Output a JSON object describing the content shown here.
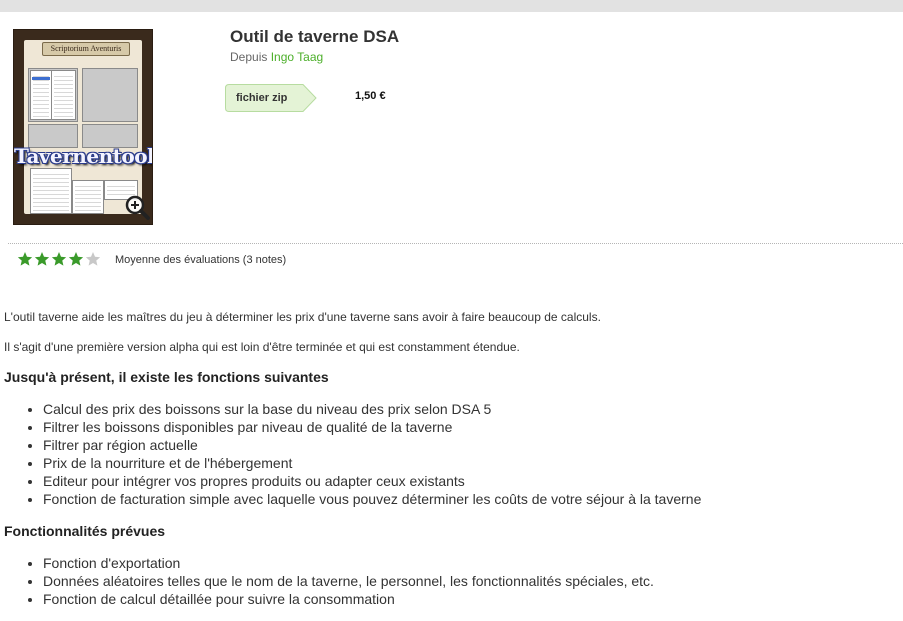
{
  "product": {
    "title": "Outil de taverne DSA",
    "byline_prefix": "Depuis",
    "author": "Ingo Taag",
    "format": "fichier zip",
    "price": "1,50 €"
  },
  "image": {
    "title_text": "Tavernentool",
    "banner_text": "Scriptorium Aventuris",
    "zoom_icon": "zoom-in-icon"
  },
  "rating": {
    "filled_stars": 4,
    "total_stars": 5,
    "label": "Moyenne des évaluations (3 notes)",
    "star_color": "#3a9a2a",
    "empty_star_color": "#c8c8c8"
  },
  "description": {
    "paragraphs": [
      "L'outil taverne aide les maîtres du jeu à déterminer les prix d'une taverne sans avoir à faire beaucoup de calculs.",
      "Il s'agit d'une première version alpha qui est loin d'être terminée et qui est constamment étendue."
    ],
    "sections": [
      {
        "heading": "Jusqu'à présent, il existe les fonctions suivantes",
        "items": [
          "Calcul des prix des boissons sur la base du niveau des prix selon DSA 5",
          "Filtrer les boissons disponibles par niveau de qualité de la taverne",
          "Filtrer par région actuelle",
          "Prix de la nourriture et de l'hébergement",
          "Editeur pour intégrer vos propres produits ou adapter ceux existants",
          "Fonction de facturation simple avec laquelle vous pouvez déterminer les coûts de votre séjour à la taverne"
        ]
      },
      {
        "heading": "Fonctionnalités prévues",
        "items": [
          "Fonction d'exportation",
          "Données aléatoires telles que le nom de la taverne, le personnel, les fonctionnalités spéciales, etc.",
          "Fonction de calcul détaillée pour suivre la consommation"
        ]
      }
    ]
  },
  "colors": {
    "accent_green": "#4caf2a",
    "tag_fill": "#e4f3d6",
    "tag_border": "#b7dca0"
  }
}
